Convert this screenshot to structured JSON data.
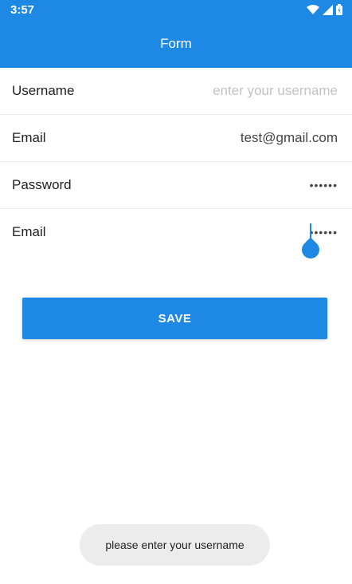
{
  "status_bar": {
    "time": "3:57",
    "icons": [
      "wifi-icon",
      "signal-icon",
      "battery-icon"
    ]
  },
  "app_bar": {
    "title": "Form"
  },
  "form": {
    "rows": [
      {
        "label": "Username",
        "value": "",
        "placeholder": "enter your username",
        "type": "text"
      },
      {
        "label": "Email",
        "value": "test@gmail.com",
        "placeholder": "",
        "type": "text"
      },
      {
        "label": "Password",
        "value": "••••••",
        "placeholder": "",
        "type": "password"
      },
      {
        "label": "Email",
        "value": "••••••",
        "placeholder": "",
        "type": "password",
        "focused": true
      }
    ]
  },
  "save_button": {
    "label": "SAVE"
  },
  "toast": {
    "message": "please enter your username"
  },
  "colors": {
    "primary": "#1e88e5",
    "toast_bg": "#ececec",
    "placeholder": "#c2c2c2"
  }
}
